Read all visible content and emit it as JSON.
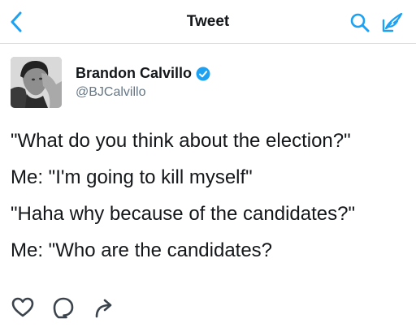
{
  "header": {
    "title": "Tweet",
    "icons": [
      "back-arrow-icon",
      "search-icon",
      "compose-icon"
    ]
  },
  "colors": {
    "accent": "#1da1f2",
    "text": "#14171a",
    "secondary": "#657786",
    "icon": "#3b444c"
  },
  "author": {
    "display_name": "Brandon Calvillo",
    "handle": "@BJCalvillo",
    "verified": true
  },
  "tweet": {
    "lines": [
      "\"What do you think about the election?\"",
      "Me: \"I'm going to kill myself\"",
      "\"Haha why because of the candidates?\"",
      "Me: \"Who are the candidates?"
    ]
  },
  "actions": {
    "icons": [
      "heart-icon",
      "reply-icon",
      "share-icon"
    ]
  }
}
